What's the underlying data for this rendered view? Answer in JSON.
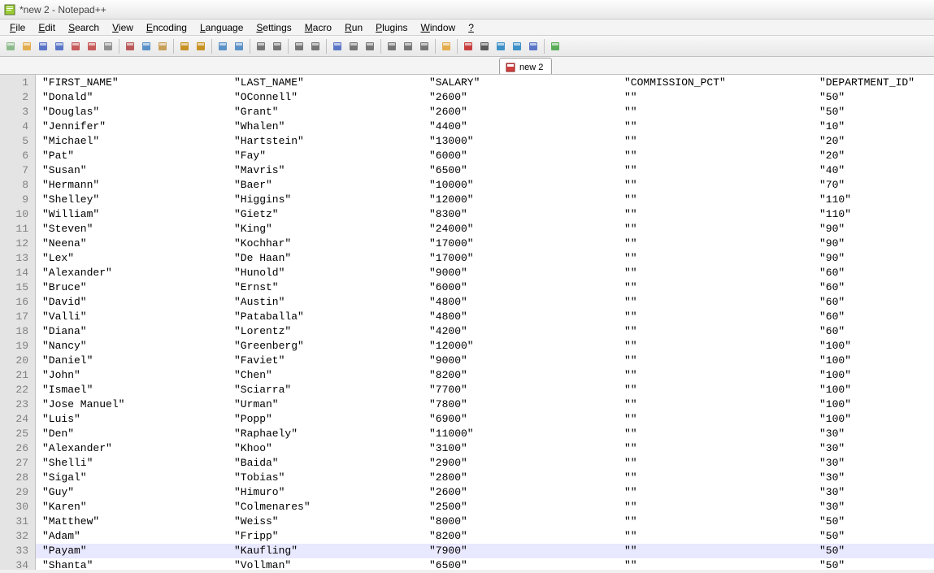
{
  "title": "*new  2 - Notepad++",
  "menus": [
    "File",
    "Edit",
    "Search",
    "View",
    "Encoding",
    "Language",
    "Settings",
    "Macro",
    "Run",
    "Plugins",
    "Window",
    "?"
  ],
  "tab_label": "new  2",
  "highlight_line": 33,
  "rows": [
    {
      "n": 1,
      "c0": "\"FIRST_NAME\"",
      "c1": "\"LAST_NAME\"",
      "c2": "\"SALARY\"",
      "c3": "\"COMMISSION_PCT\"",
      "c4": "\"DEPARTMENT_ID\""
    },
    {
      "n": 2,
      "c0": "\"Donald\"",
      "c1": "\"OConnell\"",
      "c2": "\"2600\"",
      "c3": "\"\"",
      "c4": "\"50\""
    },
    {
      "n": 3,
      "c0": "\"Douglas\"",
      "c1": "\"Grant\"",
      "c2": "\"2600\"",
      "c3": "\"\"",
      "c4": "\"50\""
    },
    {
      "n": 4,
      "c0": "\"Jennifer\"",
      "c1": "\"Whalen\"",
      "c2": "\"4400\"",
      "c3": "\"\"",
      "c4": "\"10\""
    },
    {
      "n": 5,
      "c0": "\"Michael\"",
      "c1": "\"Hartstein\"",
      "c2": "\"13000\"",
      "c3": "\"\"",
      "c4": "\"20\""
    },
    {
      "n": 6,
      "c0": "\"Pat\"",
      "c1": "\"Fay\"",
      "c2": "\"6000\"",
      "c3": "\"\"",
      "c4": "\"20\""
    },
    {
      "n": 7,
      "c0": "\"Susan\"",
      "c1": "\"Mavris\"",
      "c2": "\"6500\"",
      "c3": "\"\"",
      "c4": "\"40\""
    },
    {
      "n": 8,
      "c0": "\"Hermann\"",
      "c1": "\"Baer\"",
      "c2": "\"10000\"",
      "c3": "\"\"",
      "c4": "\"70\""
    },
    {
      "n": 9,
      "c0": "\"Shelley\"",
      "c1": "\"Higgins\"",
      "c2": "\"12000\"",
      "c3": "\"\"",
      "c4": "\"110\""
    },
    {
      "n": 10,
      "c0": "\"William\"",
      "c1": "\"Gietz\"",
      "c2": "\"8300\"",
      "c3": "\"\"",
      "c4": "\"110\""
    },
    {
      "n": 11,
      "c0": "\"Steven\"",
      "c1": "\"King\"",
      "c2": "\"24000\"",
      "c3": "\"\"",
      "c4": "\"90\""
    },
    {
      "n": 12,
      "c0": "\"Neena\"",
      "c1": "\"Kochhar\"",
      "c2": "\"17000\"",
      "c3": "\"\"",
      "c4": "\"90\""
    },
    {
      "n": 13,
      "c0": "\"Lex\"",
      "c1": "\"De Haan\"",
      "c2": "\"17000\"",
      "c3": "\"\"",
      "c4": "\"90\""
    },
    {
      "n": 14,
      "c0": "\"Alexander\"",
      "c1": "\"Hunold\"",
      "c2": "\"9000\"",
      "c3": "\"\"",
      "c4": "\"60\""
    },
    {
      "n": 15,
      "c0": "\"Bruce\"",
      "c1": "\"Ernst\"",
      "c2": "\"6000\"",
      "c3": "\"\"",
      "c4": "\"60\""
    },
    {
      "n": 16,
      "c0": "\"David\"",
      "c1": "\"Austin\"",
      "c2": "\"4800\"",
      "c3": "\"\"",
      "c4": "\"60\""
    },
    {
      "n": 17,
      "c0": "\"Valli\"",
      "c1": "\"Pataballa\"",
      "c2": "\"4800\"",
      "c3": "\"\"",
      "c4": "\"60\""
    },
    {
      "n": 18,
      "c0": "\"Diana\"",
      "c1": "\"Lorentz\"",
      "c2": "\"4200\"",
      "c3": "\"\"",
      "c4": "\"60\""
    },
    {
      "n": 19,
      "c0": "\"Nancy\"",
      "c1": "\"Greenberg\"",
      "c2": "\"12000\"",
      "c3": "\"\"",
      "c4": "\"100\""
    },
    {
      "n": 20,
      "c0": "\"Daniel\"",
      "c1": "\"Faviet\"",
      "c2": "\"9000\"",
      "c3": "\"\"",
      "c4": "\"100\""
    },
    {
      "n": 21,
      "c0": "\"John\"",
      "c1": "\"Chen\"",
      "c2": "\"8200\"",
      "c3": "\"\"",
      "c4": "\"100\""
    },
    {
      "n": 22,
      "c0": "\"Ismael\"",
      "c1": "\"Sciarra\"",
      "c2": "\"7700\"",
      "c3": "\"\"",
      "c4": "\"100\""
    },
    {
      "n": 23,
      "c0": "\"Jose Manuel\"",
      "c1": "\"Urman\"",
      "c2": "\"7800\"",
      "c3": "\"\"",
      "c4": "\"100\""
    },
    {
      "n": 24,
      "c0": "\"Luis\"",
      "c1": "\"Popp\"",
      "c2": "\"6900\"",
      "c3": "\"\"",
      "c4": "\"100\""
    },
    {
      "n": 25,
      "c0": "\"Den\"",
      "c1": "\"Raphaely\"",
      "c2": "\"11000\"",
      "c3": "\"\"",
      "c4": "\"30\""
    },
    {
      "n": 26,
      "c0": "\"Alexander\"",
      "c1": "\"Khoo\"",
      "c2": "\"3100\"",
      "c3": "\"\"",
      "c4": "\"30\""
    },
    {
      "n": 27,
      "c0": "\"Shelli\"",
      "c1": "\"Baida\"",
      "c2": "\"2900\"",
      "c3": "\"\"",
      "c4": "\"30\""
    },
    {
      "n": 28,
      "c0": "\"Sigal\"",
      "c1": "\"Tobias\"",
      "c2": "\"2800\"",
      "c3": "\"\"",
      "c4": "\"30\""
    },
    {
      "n": 29,
      "c0": "\"Guy\"",
      "c1": "\"Himuro\"",
      "c2": "\"2600\"",
      "c3": "\"\"",
      "c4": "\"30\""
    },
    {
      "n": 30,
      "c0": "\"Karen\"",
      "c1": "\"Colmenares\"",
      "c2": "\"2500\"",
      "c3": "\"\"",
      "c4": "\"30\""
    },
    {
      "n": 31,
      "c0": "\"Matthew\"",
      "c1": "\"Weiss\"",
      "c2": "\"8000\"",
      "c3": "\"\"",
      "c4": "\"50\""
    },
    {
      "n": 32,
      "c0": "\"Adam\"",
      "c1": "\"Fripp\"",
      "c2": "\"8200\"",
      "c3": "\"\"",
      "c4": "\"50\""
    },
    {
      "n": 33,
      "c0": "\"Payam\"",
      "c1": "\"Kaufling\"",
      "c2": "\"7900\"",
      "c3": "\"\"",
      "c4": "\"50\""
    },
    {
      "n": 34,
      "c0": "\"Shanta\"",
      "c1": "\"Vollman\"",
      "c2": "\"6500\"",
      "c3": "\"\"",
      "c4": "\"50\""
    }
  ],
  "toolbar_icons": [
    "new-file-icon",
    "open-icon",
    "save-icon",
    "save-all-icon",
    "close-icon",
    "close-all-icon",
    "print-icon",
    "|",
    "cut-icon",
    "copy-icon",
    "paste-icon",
    "|",
    "undo-icon",
    "redo-icon",
    "|",
    "find-icon",
    "replace-icon",
    "|",
    "zoom-in-icon",
    "zoom-out-icon",
    "|",
    "sync-v-icon",
    "sync-h-icon",
    "|",
    "wrap-icon",
    "show-all-icon",
    "indent-guide-icon",
    "|",
    "lang-icon",
    "doc-map-icon",
    "func-list-icon",
    "|",
    "folder-icon",
    "|",
    "record-icon",
    "stop-icon",
    "play-icon",
    "play-multi-icon",
    "save-macro-icon",
    "|",
    "spellcheck-icon"
  ]
}
